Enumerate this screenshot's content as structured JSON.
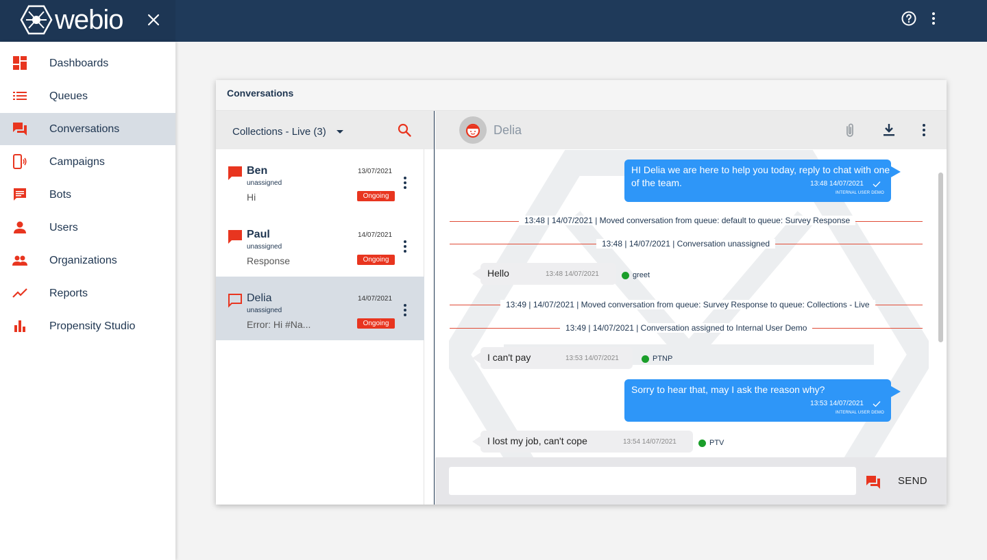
{
  "app": {
    "brand": "webio",
    "colors": {
      "topbar": "#1d3654",
      "accent": "#e8351f",
      "bubble_out": "#2e96f8",
      "status_dot": "#1a9e2a"
    }
  },
  "sidebar": {
    "items": [
      {
        "label": "Dashboards",
        "icon": "dashboard-icon"
      },
      {
        "label": "Queues",
        "icon": "list-icon"
      },
      {
        "label": "Conversations",
        "icon": "forum-icon",
        "active": true
      },
      {
        "label": "Campaigns",
        "icon": "phone-broadcast-icon"
      },
      {
        "label": "Bots",
        "icon": "chat-bubble-icon"
      },
      {
        "label": "Users",
        "icon": "person-icon"
      },
      {
        "label": "Organizations",
        "icon": "people-icon"
      },
      {
        "label": "Reports",
        "icon": "trending-line-icon"
      },
      {
        "label": "Propensity Studio",
        "icon": "bar-chart-icon"
      }
    ]
  },
  "card": {
    "title": "Conversations"
  },
  "conv_list": {
    "queue_label": "Collections - Live (3)",
    "items": [
      {
        "name": "Ben",
        "sub": "unassigned",
        "preview": "Hi",
        "date": "13/07/2021",
        "status": "Ongoing"
      },
      {
        "name": "Paul",
        "sub": "unassigned",
        "preview": "Response",
        "date": "14/07/2021",
        "status": "Ongoing"
      },
      {
        "name": "Delia",
        "sub": "unassigned",
        "preview": "Error: Hi #Na...",
        "date": "14/07/2021",
        "status": "Ongoing",
        "selected": true
      }
    ]
  },
  "chat": {
    "contact_name": "Delia",
    "messages": [
      {
        "type": "out",
        "text_line1": "HI Delia we are here to help you today, reply to chat with one",
        "text_line2": "of the team.",
        "time": "13:48 14/07/2021",
        "sender": "INTERNAL USER DEMO"
      },
      {
        "type": "system",
        "text": "13:48 | 14/07/2021 | Moved conversation from queue: default to queue: Survey Response"
      },
      {
        "type": "system",
        "text": "13:48 | 14/07/2021 | Conversation unassigned"
      },
      {
        "type": "in",
        "text": "Hello",
        "time": "13:48 14/07/2021",
        "intent": "greet"
      },
      {
        "type": "system",
        "text": "13:49 | 14/07/2021 | Moved conversation from queue: Survey Response to queue: Collections - Live"
      },
      {
        "type": "system",
        "text": "13:49 | 14/07/2021 | Conversation assigned to Internal User Demo"
      },
      {
        "type": "in",
        "text": "I can't pay",
        "time": "13:53 14/07/2021",
        "intent": "PTNP"
      },
      {
        "type": "out",
        "text_line1": "Sorry to hear that, may I ask the reason why?",
        "time": "13:53 14/07/2021",
        "sender": "INTERNAL USER DEMO"
      },
      {
        "type": "in",
        "text": "I lost my job, can't cope",
        "time": "13:54 14/07/2021",
        "intent": "PTV"
      }
    ],
    "input_value": "",
    "input_placeholder": "",
    "send_label": "SEND"
  }
}
